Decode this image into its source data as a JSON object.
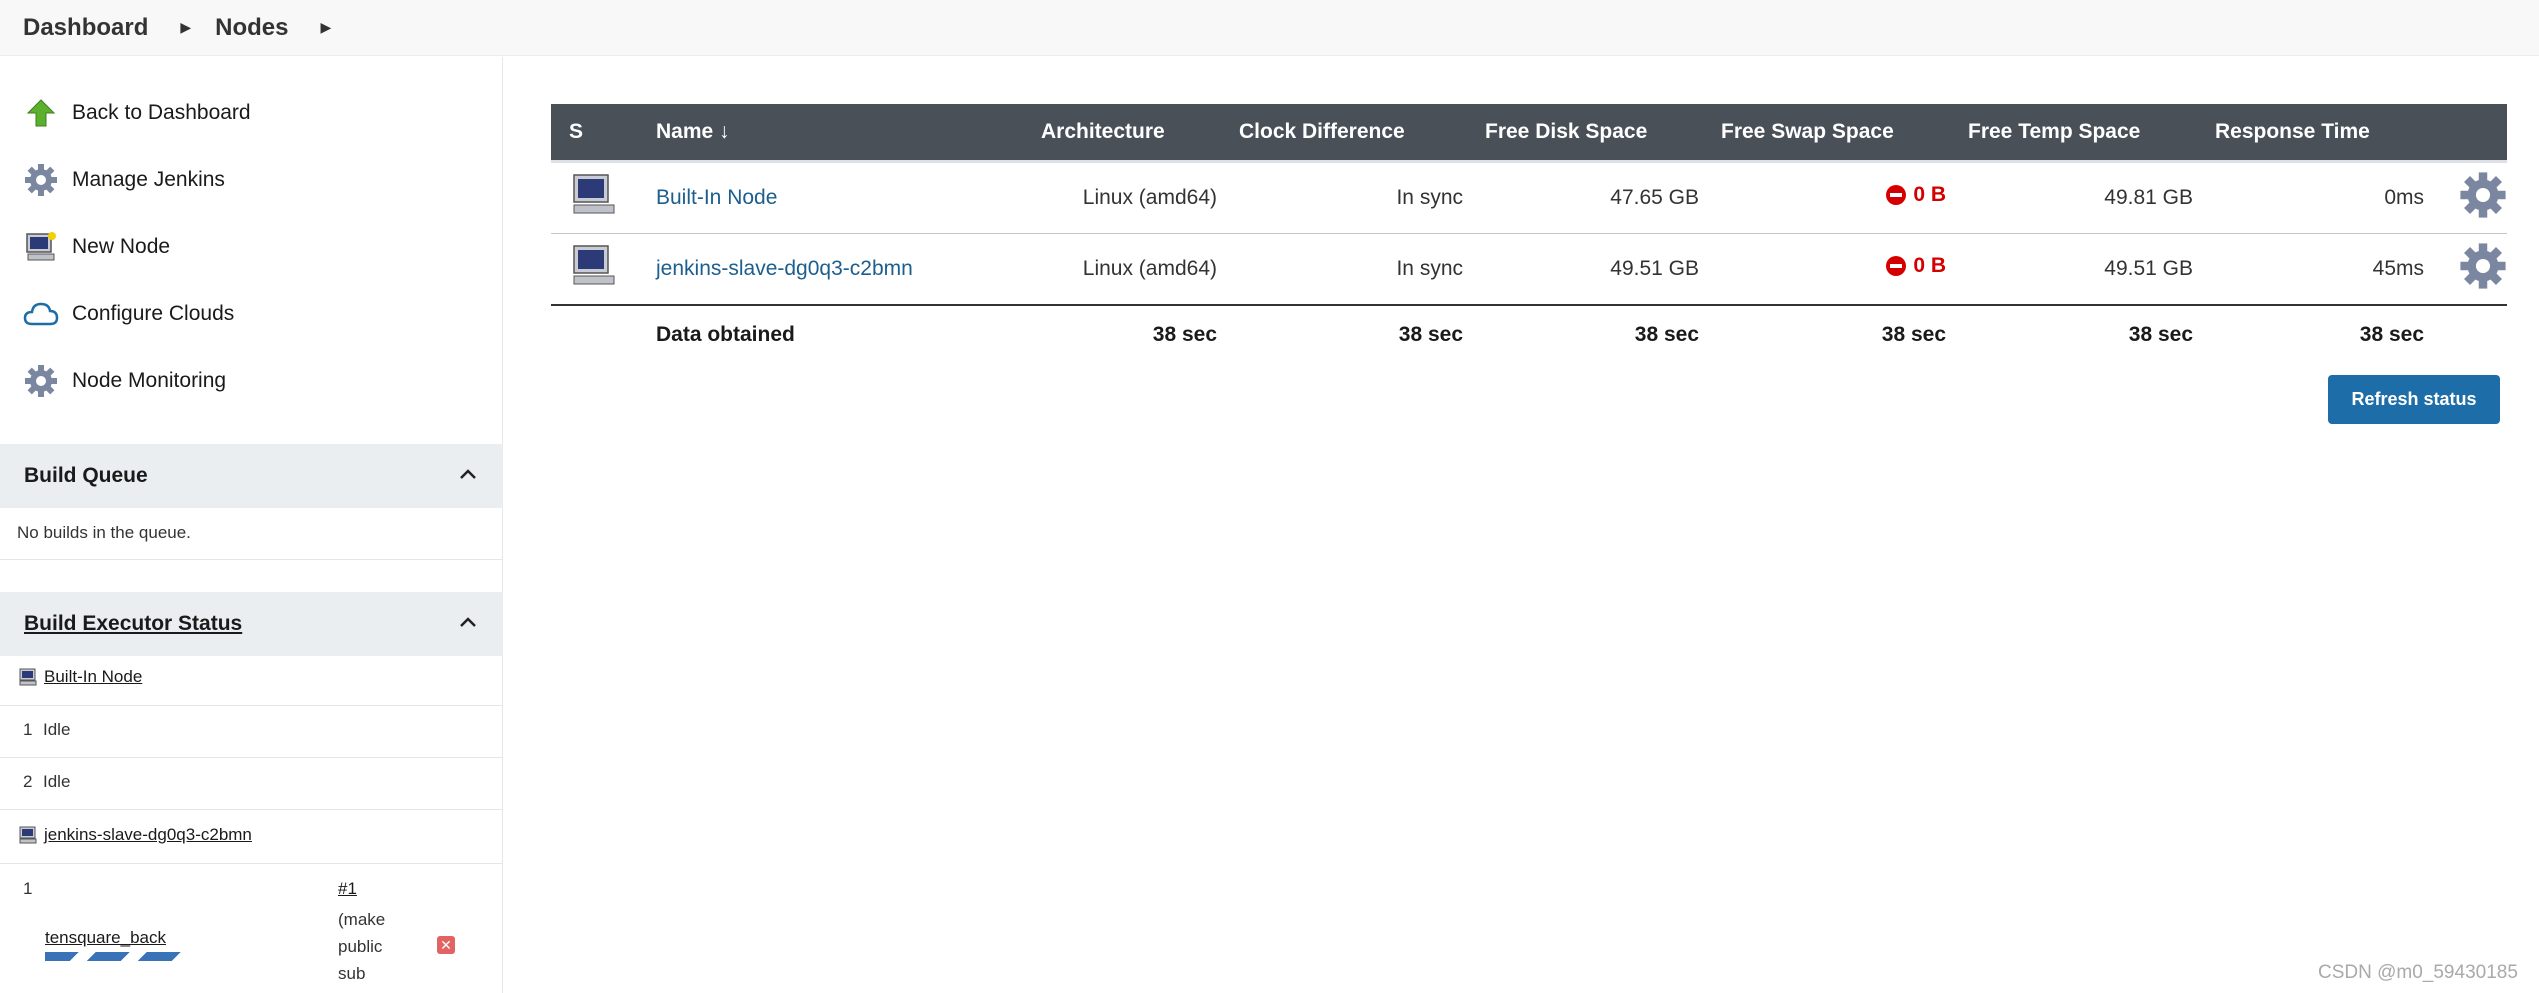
{
  "breadcrumb": [
    "Dashboard",
    "Nodes"
  ],
  "sidebar": {
    "tasks": [
      {
        "label": "Back to Dashboard",
        "icon": "up-arrow-icon"
      },
      {
        "label": "Manage Jenkins",
        "icon": "gear-icon"
      },
      {
        "label": "New Node",
        "icon": "computer-icon"
      },
      {
        "label": "Configure Clouds",
        "icon": "cloud-icon"
      },
      {
        "label": "Node Monitoring",
        "icon": "gear-icon"
      }
    ],
    "build_queue": {
      "title": "Build Queue",
      "empty_text": "No builds in the queue."
    },
    "executor_status": {
      "title": "Build Executor Status",
      "nodes": [
        {
          "name": "Built-In Node",
          "executors": [
            {
              "num": "1",
              "state": "Idle"
            },
            {
              "num": "2",
              "state": "Idle"
            }
          ]
        },
        {
          "name": "jenkins-slave-dg0q3-c2bmn",
          "executors": [
            {
              "num": "1",
              "job": "tensquare_back",
              "build": "#1",
              "build_desc": "(make public sub"
            }
          ]
        }
      ]
    }
  },
  "table": {
    "headers": [
      "S",
      "Name  ↓",
      "Architecture",
      "Clock Difference",
      "Free Disk Space",
      "Free Swap Space",
      "Free Temp Space",
      "Response Time"
    ],
    "rows": [
      {
        "name": "Built-In Node",
        "arch": "Linux (amd64)",
        "clock": "In sync",
        "disk": "47.65 GB",
        "swap": "0 B",
        "temp": "49.81 GB",
        "response": "0ms"
      },
      {
        "name": "jenkins-slave-dg0q3-c2bmn",
        "arch": "Linux (amd64)",
        "clock": "In sync",
        "disk": "49.51 GB",
        "swap": "0 B",
        "temp": "49.51 GB",
        "response": "45ms"
      }
    ],
    "footer": {
      "label": "Data obtained",
      "arch": "38 sec",
      "clock": "38 sec",
      "disk": "38 sec",
      "swap": "38 sec",
      "temp": "38 sec",
      "response": "38 sec"
    }
  },
  "refresh_label": "Refresh status",
  "watermark": "CSDN @m0_59430185",
  "colors": {
    "header_bg": "#4a5058",
    "link": "#1c5e8e",
    "button": "#1d6ea8",
    "error": "#d40000"
  }
}
